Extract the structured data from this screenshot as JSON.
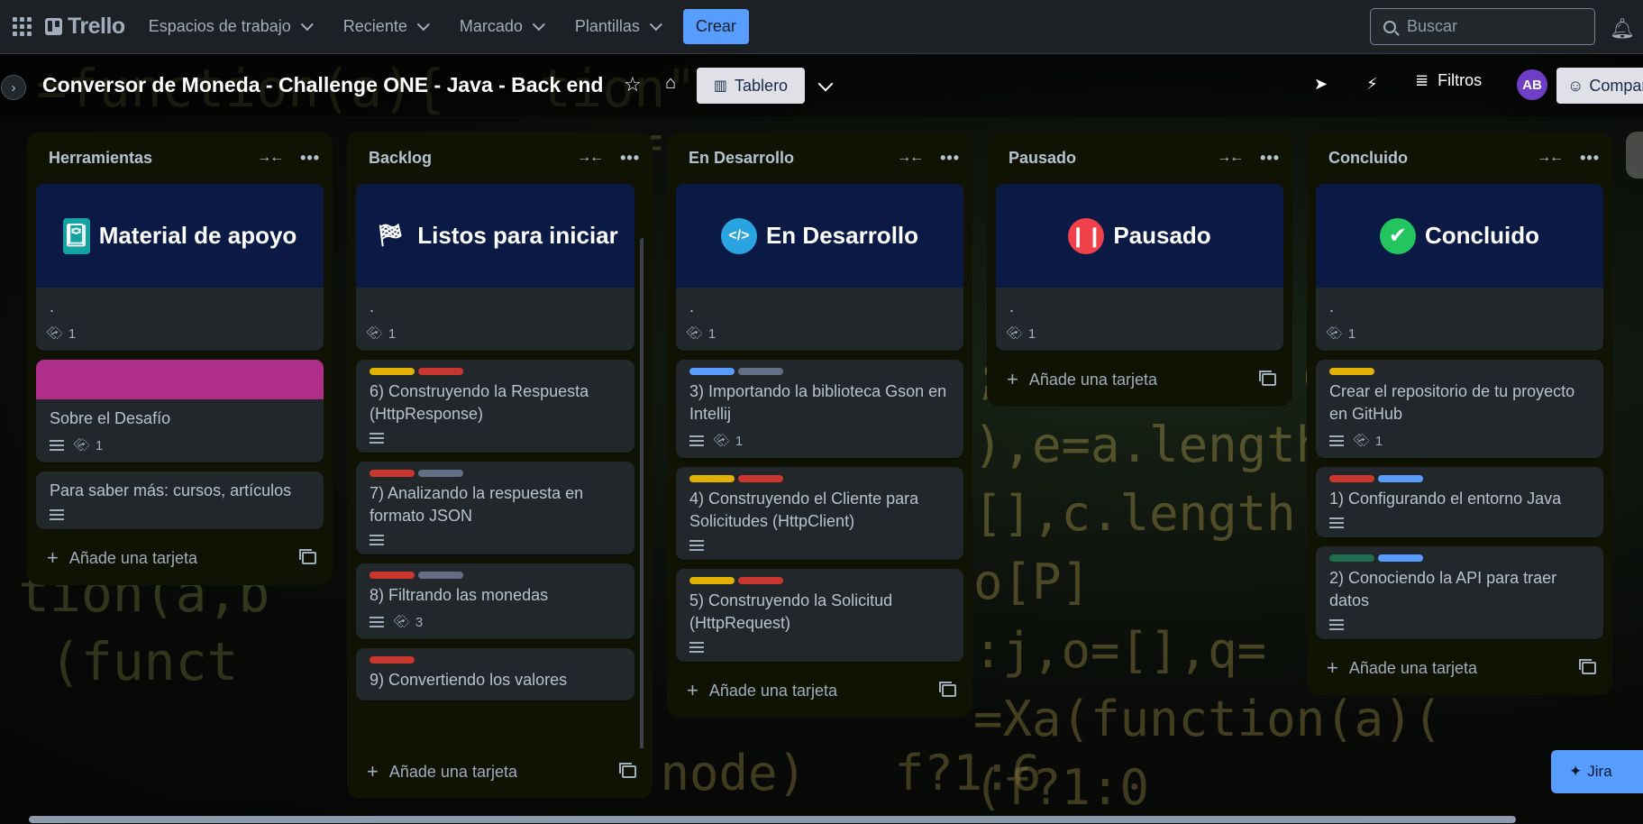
{
  "topnav": {
    "logo": "Trello",
    "items": [
      {
        "label": "Espacios de trabajo"
      },
      {
        "label": "Reciente"
      },
      {
        "label": "Marcado"
      },
      {
        "label": "Plantillas"
      }
    ],
    "create_label": "Crear",
    "search_placeholder": "Buscar"
  },
  "board": {
    "title": "Conversor de Moneda - Challenge ONE - Java - Back end",
    "view_label": "Tablero",
    "filters_label": "Filtros",
    "avatar_initials": "AB",
    "share_label": "Compartir"
  },
  "add_card_label": "Añade una tarjeta",
  "jira_label": "Jira",
  "colors": {
    "yellow": "#e2b203",
    "red": "#c9372c",
    "gray": "#626f86",
    "blue": "#579dff",
    "green": "#216e4e",
    "magenta": "#ae2e88"
  },
  "lists": [
    {
      "name": "Herramientas",
      "cards": [
        {
          "cover_title": "Material de apoyo",
          "cover_icon": "notebook-icon",
          "title": ".",
          "attachments": "1"
        },
        {
          "color_cover": "magenta",
          "title": "Sobre el Desafío",
          "description": true,
          "attachments": "1"
        },
        {
          "title": "Para saber más: cursos, artículos",
          "description": true
        }
      ]
    },
    {
      "name": "Backlog",
      "cards": [
        {
          "cover_title": "Listos para iniciar",
          "cover_icon": "checkered-flag-icon",
          "title": ".",
          "attachments": "1"
        },
        {
          "labels": [
            "yellow",
            "red"
          ],
          "title": "6) Construyendo la Respuesta (HttpResponse)",
          "description": true
        },
        {
          "labels": [
            "red",
            "gray"
          ],
          "title": "7) Analizando la respuesta en formato JSON",
          "description": true
        },
        {
          "labels": [
            "red",
            "gray"
          ],
          "title": "8) Filtrando las monedas",
          "description": true,
          "attachments": "3"
        },
        {
          "labels": [
            "red"
          ],
          "title": "9) Convertiendo los valores"
        }
      ]
    },
    {
      "name": "En Desarrollo",
      "cards": [
        {
          "cover_title": "En Desarrollo",
          "cover_icon": "laptop-code-icon",
          "title": ".",
          "attachments": "1"
        },
        {
          "labels": [
            "blue",
            "gray"
          ],
          "title": "3) Importando la biblioteca Gson en Intellij",
          "description": true,
          "attachments": "1"
        },
        {
          "labels": [
            "yellow",
            "red"
          ],
          "title": "4) Construyendo el Cliente para Solicitudes (HttpClient)",
          "description": true
        },
        {
          "labels": [
            "yellow",
            "red"
          ],
          "title": "5) Construyendo la Solicitud (HttpRequest)",
          "description": true
        }
      ]
    },
    {
      "name": "Pausado",
      "cards": [
        {
          "cover_title": "Pausado",
          "cover_icon": "pause-icon",
          "title": ".",
          "attachments": "1"
        }
      ]
    },
    {
      "name": "Concluido",
      "cards": [
        {
          "cover_title": "Concluido",
          "cover_icon": "check-icon",
          "title": ".",
          "attachments": "1"
        },
        {
          "labels": [
            "yellow"
          ],
          "title": "Crear el repositorio de tu proyecto en GitHub",
          "description": true,
          "attachments": "1"
        },
        {
          "labels": [
            "red",
            "blue"
          ],
          "title": "1) Configurando el entorno Java",
          "description": true
        },
        {
          "labels": [
            "green",
            "blue"
          ],
          "title": "2) Conociendo la API para traer datos",
          "description": true
        }
      ]
    }
  ]
}
